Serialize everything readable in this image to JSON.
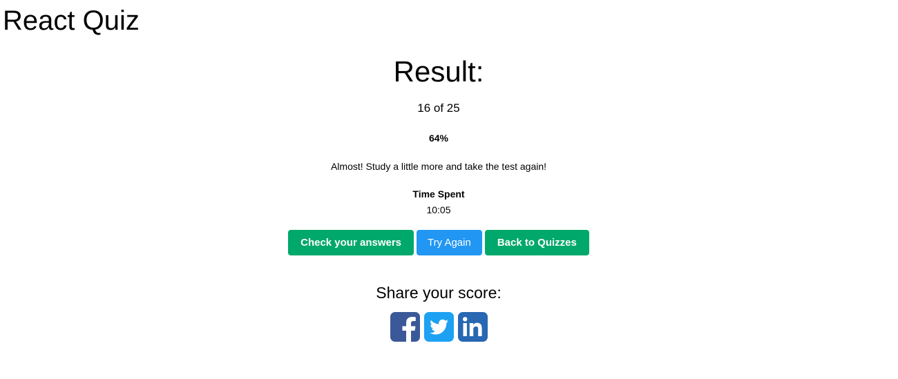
{
  "app": {
    "title": "React Quiz"
  },
  "result": {
    "heading": "Result:",
    "score": "16 of 25",
    "percent": "64%",
    "message": "Almost! Study a little more and take the test again!",
    "time_label": "Time Spent",
    "time_value": "10:05"
  },
  "actions": {
    "check_answers": "Check your answers",
    "try_again": "Try Again",
    "back_to_quizzes": "Back to Quizzes"
  },
  "share": {
    "heading": "Share your score:",
    "networks": [
      {
        "name": "facebook",
        "icon": "facebook-icon",
        "color": "#3b5998"
      },
      {
        "name": "twitter",
        "icon": "twitter-icon",
        "color": "#1da1f2"
      },
      {
        "name": "linkedin",
        "icon": "linkedin-icon",
        "color": "#2867b2"
      }
    ]
  },
  "colors": {
    "primary_green": "#00a86b",
    "primary_blue": "#2196f3"
  }
}
